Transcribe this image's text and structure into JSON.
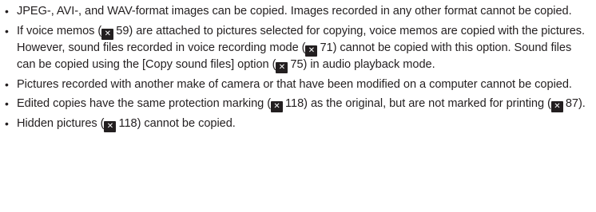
{
  "bullet_symbol": "•",
  "ref_icon_glyph": "✕",
  "bullets": [
    {
      "segments": [
        {
          "t": "JPEG-, AVI-, and WAV-format images can be copied. Images recorded in any other format cannot be copied."
        }
      ]
    },
    {
      "segments": [
        {
          "t": "If voice memos ("
        },
        {
          "ref": "59"
        },
        {
          "t": ") are attached to pictures selected for copying, voice memos are copied with the pictures. However, sound files recorded in voice recording mode ("
        },
        {
          "ref": "71"
        },
        {
          "t": ") cannot be copied with this option. Sound files can be copied using the [Copy sound files] option ("
        },
        {
          "ref": "75"
        },
        {
          "t": ") in audio playback mode."
        }
      ]
    },
    {
      "segments": [
        {
          "t": "Pictures recorded with another make of camera or that have been modified on a computer cannot be copied."
        }
      ]
    },
    {
      "segments": [
        {
          "t": "Edited copies have the same protection marking ("
        },
        {
          "ref": "118"
        },
        {
          "t": ") as the original, but are not marked for printing ("
        },
        {
          "ref": "87"
        },
        {
          "t": ")."
        }
      ]
    },
    {
      "segments": [
        {
          "t": "Hidden pictures ("
        },
        {
          "ref": "118"
        },
        {
          "t": ") cannot be copied."
        }
      ]
    }
  ]
}
